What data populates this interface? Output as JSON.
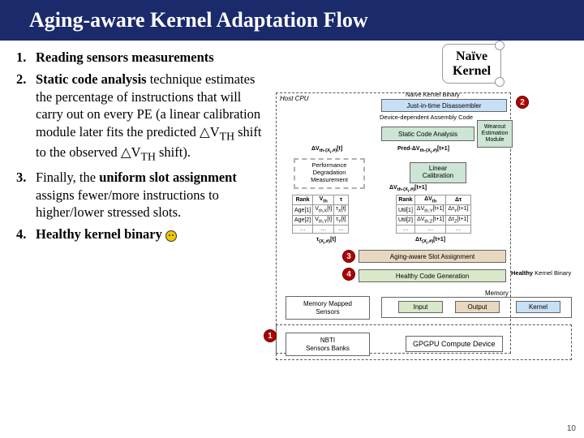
{
  "title": "Aging-aware Kernel Adaptation Flow",
  "steps": [
    {
      "num": "1.",
      "text": "Reading sensors measurements"
    },
    {
      "num": "2.",
      "text": "Static code analysis technique estimates the percentage of instructions that will carry out on every PE (a linear calibration module later fits the predicted △V<sub>TH</sub> shift to the observed △V<sub>TH</sub> shift)."
    },
    {
      "num": "3.",
      "text": "Finally, the uniform slot assignment assigns fewer/more instructions to higher/lower stressed slots."
    },
    {
      "num": "4.",
      "text": "Healthy kernel binary "
    }
  ],
  "diagram": {
    "naive_kernel": "Naïve\nKernel",
    "host_cpu": "Host CPU",
    "naive_kernel_binary": "Naïve Kernel Binary",
    "jit_disasm": "Just-in-time Disassembler",
    "device_dep_code": "Device-dependent Assembly Code",
    "static_code_analysis": "Static Code Analysis",
    "wearout_module": "Wearout Estimation Module",
    "linear_calibration": "Linear\nCalibration",
    "slot_assignment": "Aging-aware Slot Assignment",
    "healthy_code_gen": "Healthy Code Generation",
    "healthy_kernel_binary": "Healthy Kernel Binary",
    "memory": "Memory",
    "input": "Input",
    "output": "Output",
    "kernel": "Kernel",
    "memory_mapped_sensors": "Memory Mapped\nSensors",
    "nbti_sensors": "NBTI\nSensors Banks",
    "gpgpu": "GPGPU Compute Device",
    "pdm": "Performance\nDegradation\nMeasurement",
    "pred_dvth": "Pred-ΔV",
    "dvth": "ΔV",
    "tbl1": {
      "headers": [
        "Rank",
        "V",
        "τ"
      ],
      "rows": [
        [
          "Age[1]",
          "V",
          "τ"
        ],
        [
          "Age[2]",
          "V",
          "τ"
        ]
      ]
    },
    "tbl2": {
      "headers": [
        "Rank",
        "ΔV",
        "Δτ"
      ],
      "rows": [
        [
          "Util[1]",
          "ΔV",
          "Δτ"
        ],
        [
          "Util[2]",
          "ΔV",
          "Δτ"
        ]
      ]
    }
  },
  "slide": "10"
}
